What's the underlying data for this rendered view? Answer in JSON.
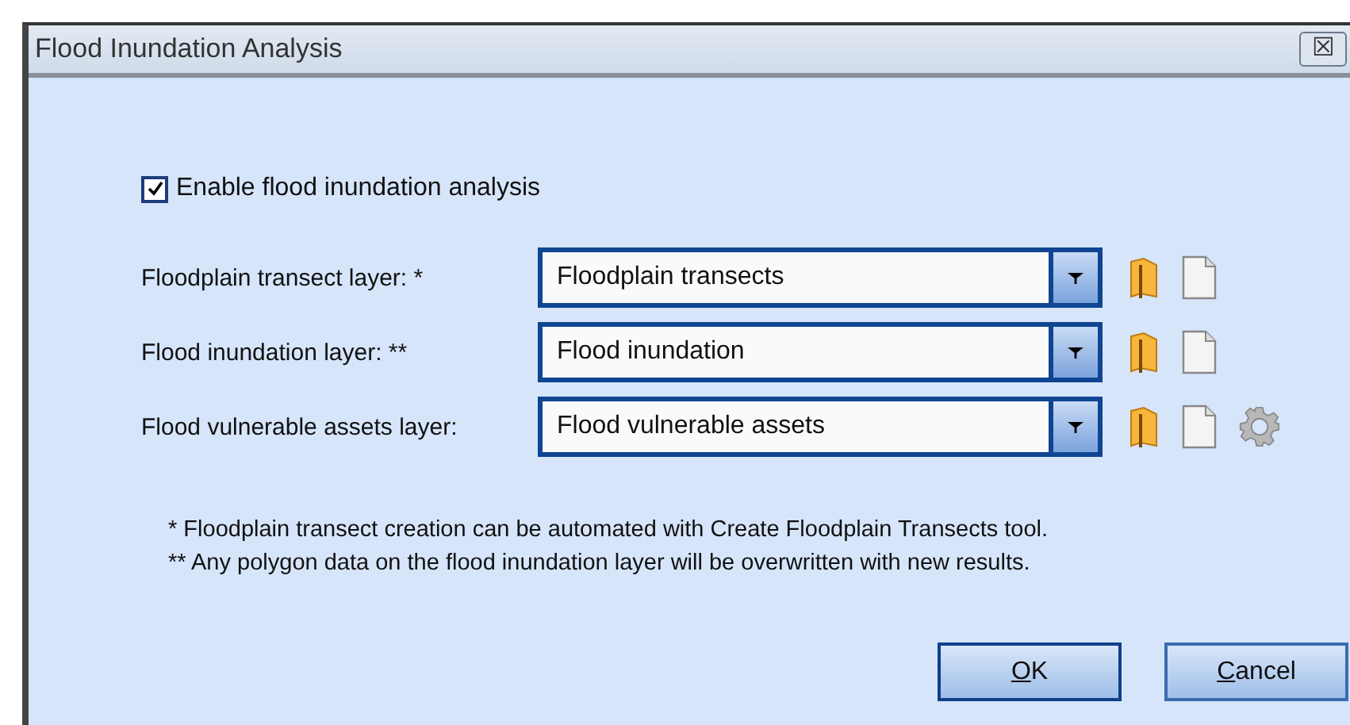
{
  "window": {
    "title": "Flood Inundation Analysis",
    "close_glyph": "☒"
  },
  "enable": {
    "label": "Enable flood inundation analysis",
    "checked": true
  },
  "layers": [
    {
      "label": "Floodplain transect layer: *",
      "value": "Floodplain transects",
      "settings": false
    },
    {
      "label": "Flood inundation layer: **",
      "value": "Flood inundation",
      "settings": false
    },
    {
      "label": "Flood vulnerable assets layer:",
      "value": "Flood vulnerable assets",
      "settings": true
    }
  ],
  "notes": [
    "*   Floodplain transect creation can be automated with Create Floodplain Transects tool.",
    "** Any polygon data on the flood inundation layer will be overwritten with new results."
  ],
  "buttons": [
    {
      "label": "OK",
      "kind": "default",
      "mnemonic": true
    },
    {
      "label": "Cancel",
      "kind": "normal",
      "mnemonic": true
    }
  ]
}
